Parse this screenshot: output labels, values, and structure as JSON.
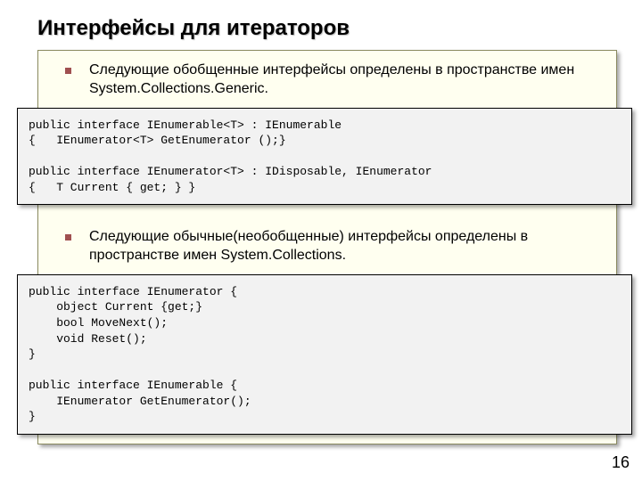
{
  "title": "Интерфейсы для итераторов",
  "bullet1": "Следующие обобщенные интерфейсы определены в пространстве имен System.Collections.Generic.",
  "code1": "public interface IEnumerable<T> : IEnumerable\n{   IEnumerator<T> GetEnumerator ();}\n\npublic interface IEnumerator<T> : IDisposable, IEnumerator\n{   T Current { get; } }",
  "bullet2": "Следующие обычные(необобщенные) интерфейсы определены в пространстве имен System.Collections.",
  "code2": "public interface IEnumerator {\n    object Current {get;}\n    bool MoveNext();\n    void Reset();\n}\n\npublic interface IEnumerable {\n    IEnumerator GetEnumerator();\n}",
  "page_number": "16"
}
